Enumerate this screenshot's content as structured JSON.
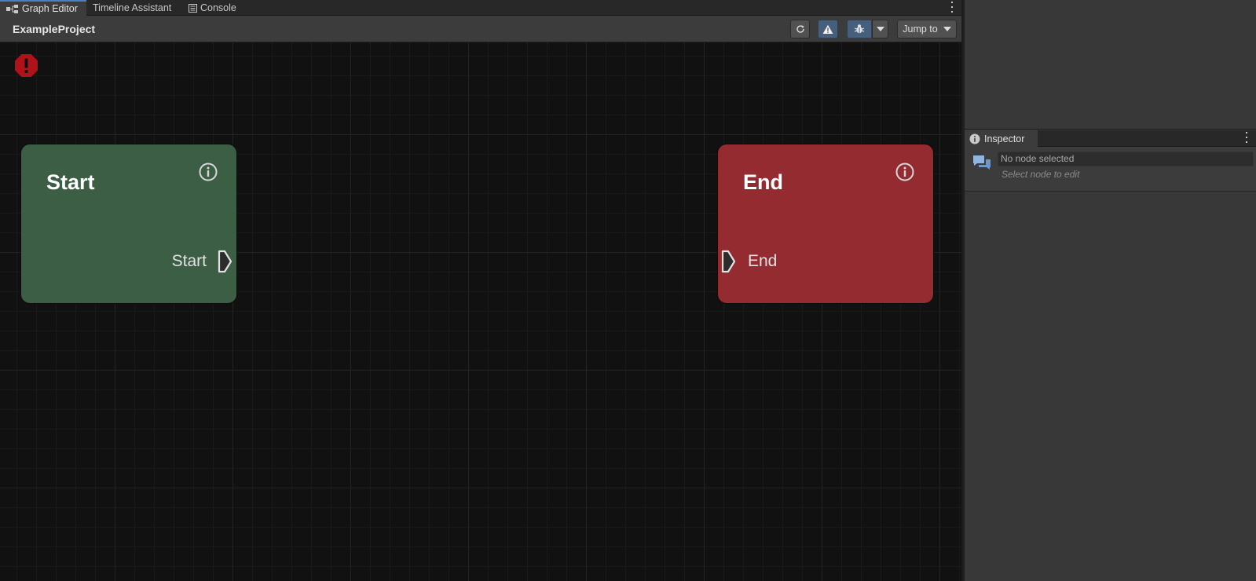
{
  "tabs": [
    {
      "label": "Graph Editor",
      "icon": "graph-icon",
      "active": true
    },
    {
      "label": "Timeline Assistant",
      "icon": "",
      "active": false
    },
    {
      "label": "Console",
      "icon": "console-icon",
      "active": false
    }
  ],
  "toolbar": {
    "project_title": "ExampleProject",
    "refresh_icon": "refresh-icon",
    "warning_icon": "warning-icon",
    "debug_icon": "bug-icon",
    "jump_to_label": "Jump to"
  },
  "canvas": {
    "error_icon": "error-octagon-icon",
    "nodes": {
      "start": {
        "title": "Start",
        "port_label": "Start",
        "color": "#3c5e45"
      },
      "end": {
        "title": "End",
        "port_label": "End",
        "color": "#932b31"
      }
    }
  },
  "inspector": {
    "tab_label": "Inspector",
    "field_value": "No node selected",
    "hint": "Select node to edit"
  },
  "colors": {
    "accent": "#4a7fc0",
    "start_node": "#3c5e45",
    "end_node": "#932b31",
    "error": "#b0121a"
  }
}
